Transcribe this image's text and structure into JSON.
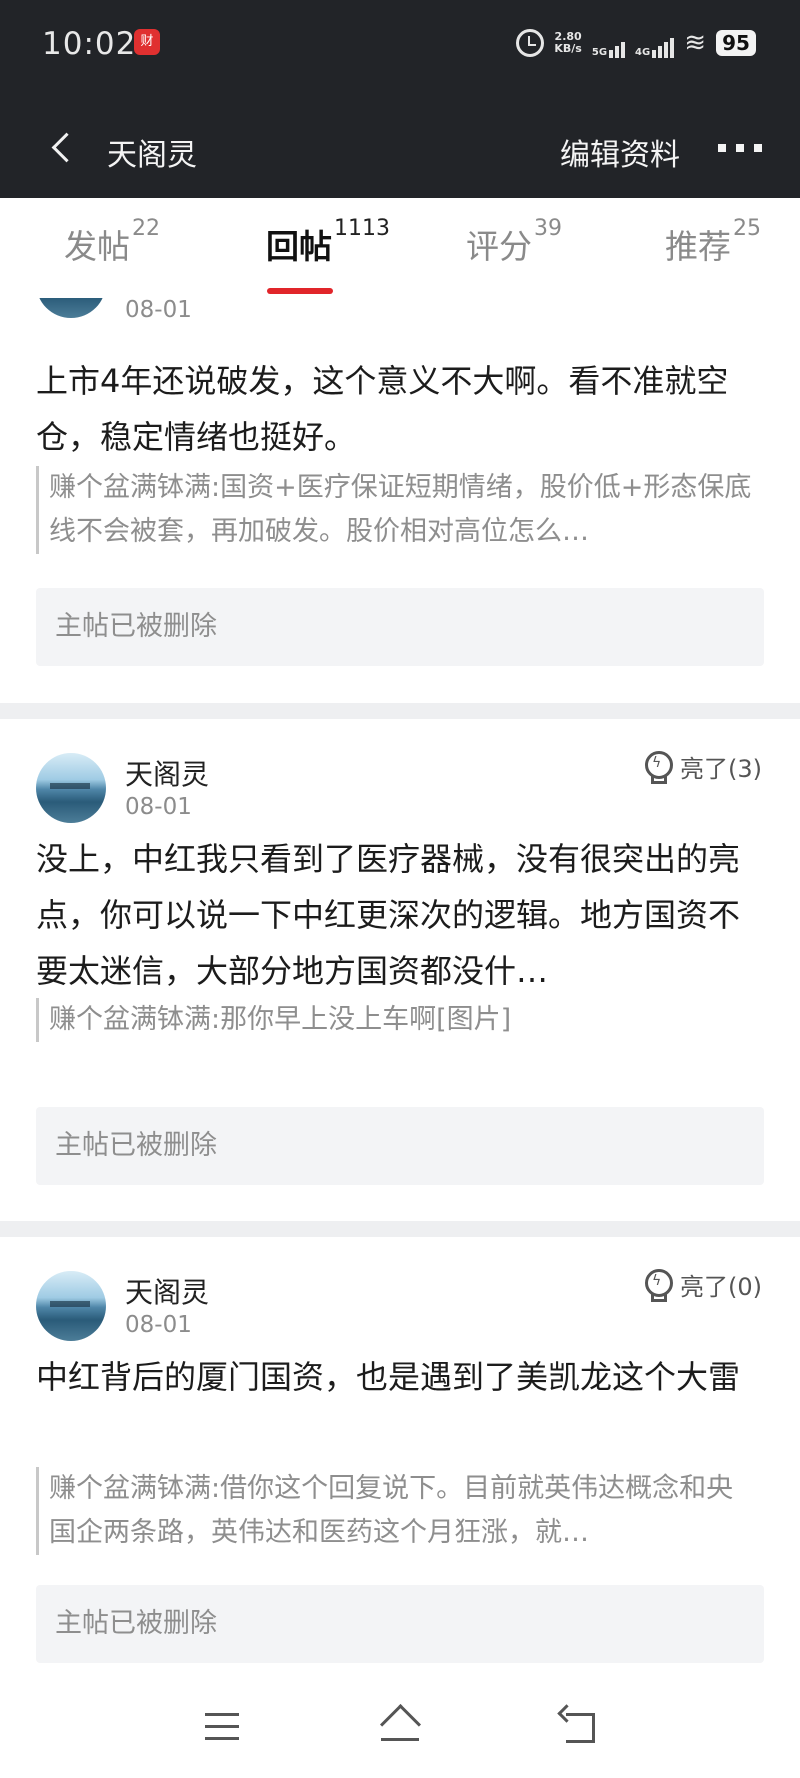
{
  "status_bar": {
    "time": "10:02",
    "app_badge": "财",
    "net_speed": "2.80",
    "net_speed_unit": "KB/s",
    "net_5g": "5G",
    "net_4g": "4G",
    "battery": "95"
  },
  "header": {
    "title": "天阁灵",
    "edit_label": "编辑资料"
  },
  "tabs": [
    {
      "label": "发帖",
      "count": "22"
    },
    {
      "label": "回帖",
      "count": "1113"
    },
    {
      "label": "评分",
      "count": "39"
    },
    {
      "label": "推荐",
      "count": "25"
    }
  ],
  "posts": [
    {
      "date": "08-01",
      "body": "上市4年还说破发，这个意义不大啊。看不准就空仓，稳定情绪也挺好。",
      "quote": "赚个盆满钵满:国资+医疗保证短期情绪，股价低+形态保底线不会被套，再加破发。股价相对高位怎么…",
      "deleted": "主帖已被删除"
    },
    {
      "username": "天阁灵",
      "date": "08-01",
      "likes": "亮了(3)",
      "body": "没上，中红我只看到了医疗器械，没有很突出的亮点，你可以说一下中红更深次的逻辑。地方国资不要太迷信，大部分地方国资都没什…",
      "quote": "赚个盆满钵满:那你早上没上车啊[图片]",
      "deleted": "主帖已被删除"
    },
    {
      "username": "天阁灵",
      "date": "08-01",
      "likes": "亮了(0)",
      "body": "中红背后的厦门国资，也是遇到了美凯龙这个大雷",
      "quote": "赚个盆满钵满:借你这个回复说下。目前就英伟达概念和央国企两条路，英伟达和医药这个月狂涨，就…",
      "deleted": "主帖已被删除"
    }
  ]
}
